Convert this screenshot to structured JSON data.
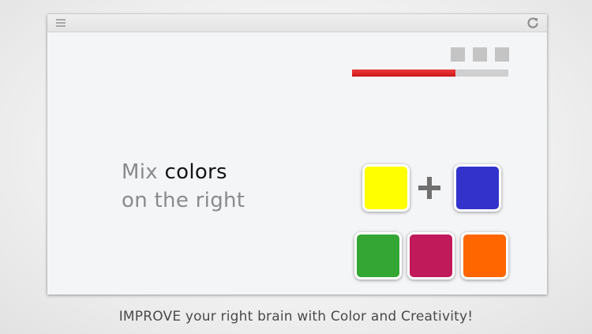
{
  "toolbar": {
    "menu_icon": "hamburger-menu-icon",
    "refresh_icon": "refresh-icon"
  },
  "status": {
    "lives_total": 3,
    "progress_fraction": 0.66,
    "progress_color": "#dd2222"
  },
  "instruction": {
    "word_mix": "Mix ",
    "word_colors": "colors",
    "line2": "on the right"
  },
  "equation": {
    "operand_1_color": "#ffff00",
    "operator": "plus-icon",
    "operand_2_color": "#3333cc"
  },
  "choices": [
    {
      "color": "#33a633"
    },
    {
      "color": "#c01a5a"
    },
    {
      "color": "#ff6600"
    }
  ],
  "caption": "IMPROVE your right brain with Color and Creativity!"
}
